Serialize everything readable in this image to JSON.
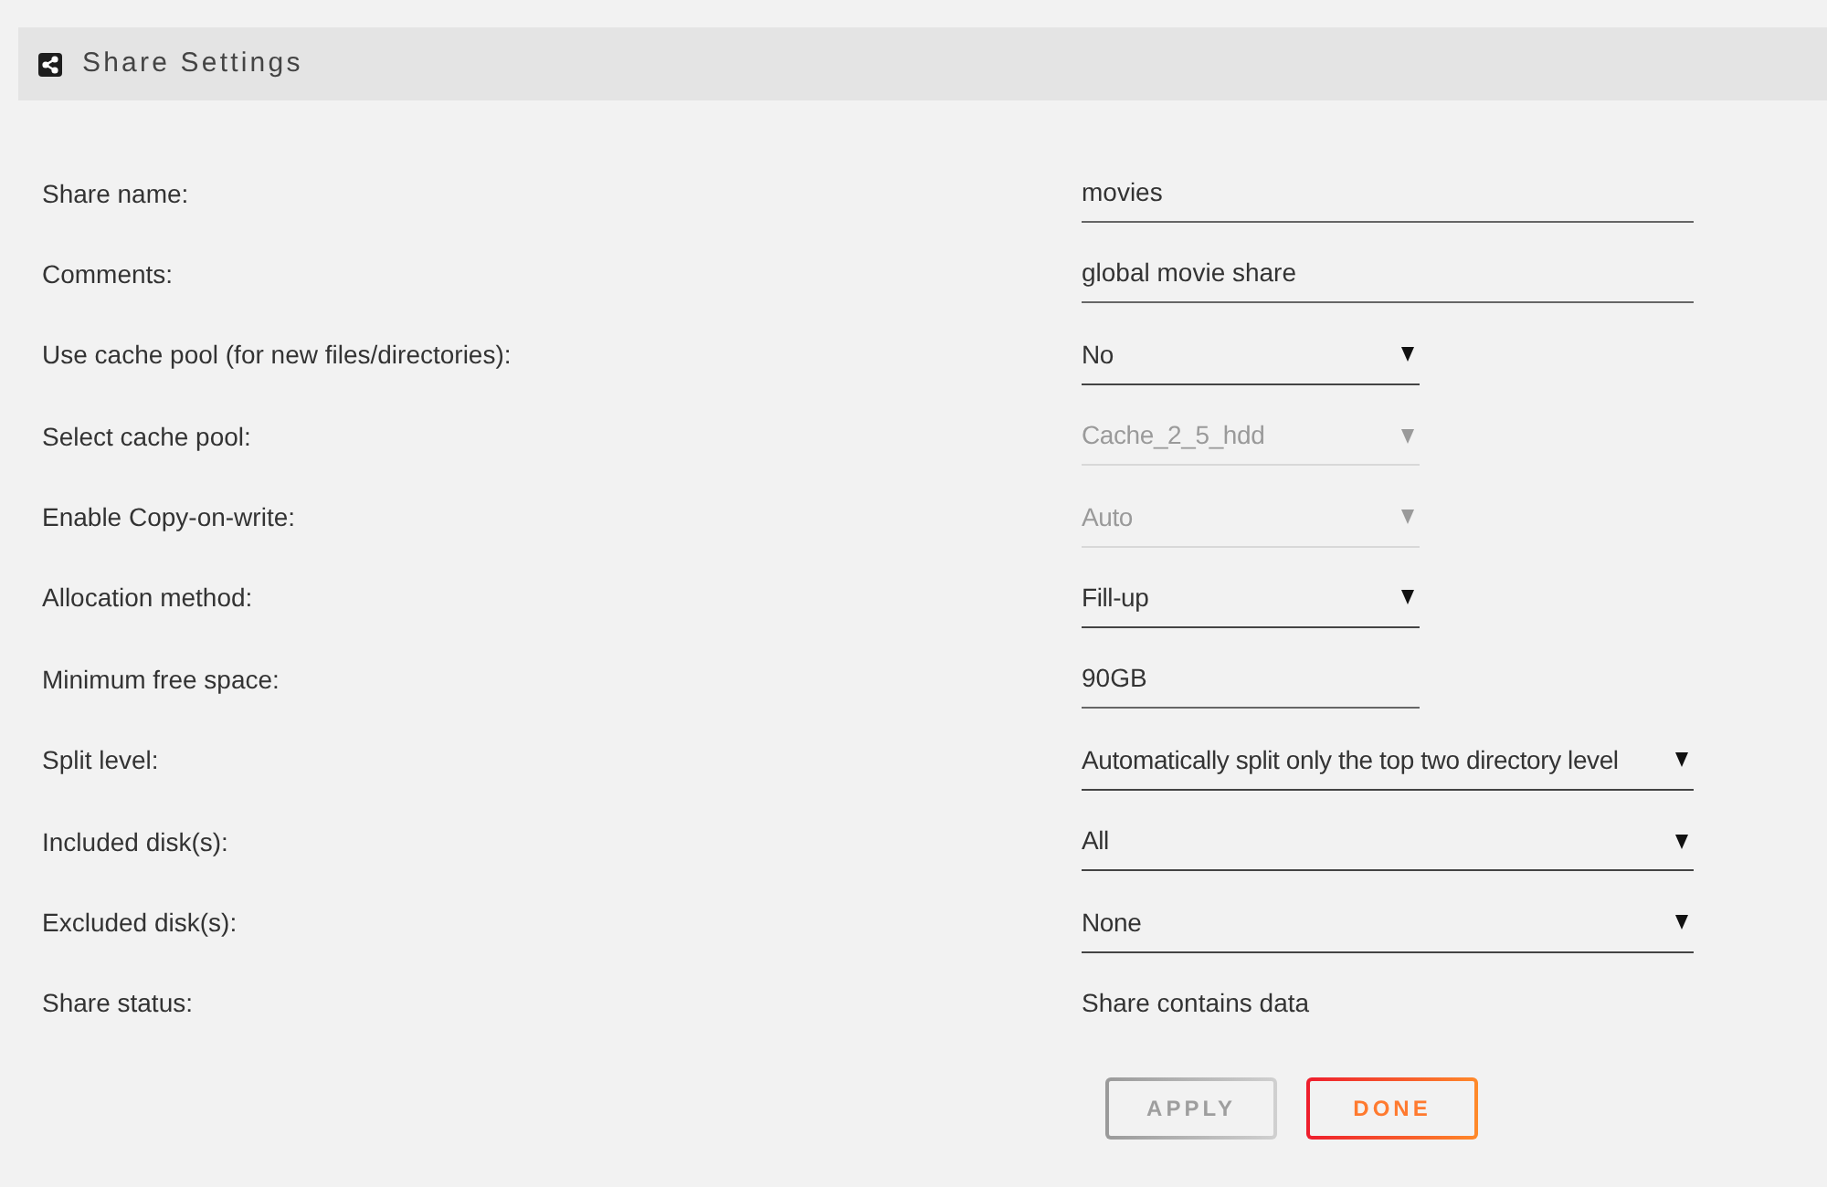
{
  "header": {
    "title": "Share Settings"
  },
  "rows": [
    {
      "label": "Share name:",
      "kind": "input",
      "value": "movies",
      "disabled": false
    },
    {
      "label": "Comments:",
      "kind": "input",
      "value": "global movie share",
      "disabled": false
    },
    {
      "label": "Use cache pool (for new files/directories):",
      "kind": "select",
      "value": "No",
      "disabled": false
    },
    {
      "label": "Select cache pool:",
      "kind": "select",
      "value": "Cache_2_5_hdd",
      "disabled": true
    },
    {
      "label": "Enable Copy-on-write:",
      "kind": "select",
      "value": "Auto",
      "disabled": true
    },
    {
      "label": "Allocation method:",
      "kind": "select",
      "value": "Fill-up",
      "disabled": false
    },
    {
      "label": "Minimum free space:",
      "kind": "input",
      "value": "90GB",
      "disabled": false
    },
    {
      "label": "Split level:",
      "kind": "select",
      "value": "Automatically split only the top two directory level",
      "disabled": false
    },
    {
      "label": "Included disk(s):",
      "kind": "select",
      "value": "All",
      "disabled": false
    },
    {
      "label": "Excluded disk(s):",
      "kind": "select",
      "value": "None",
      "disabled": false
    },
    {
      "label": "Share status:",
      "kind": "static",
      "value": "Share contains data",
      "disabled": false
    }
  ],
  "buttons": [
    {
      "label": "APPLY",
      "disabled": true
    },
    {
      "label": "DONE",
      "disabled": false
    }
  ]
}
